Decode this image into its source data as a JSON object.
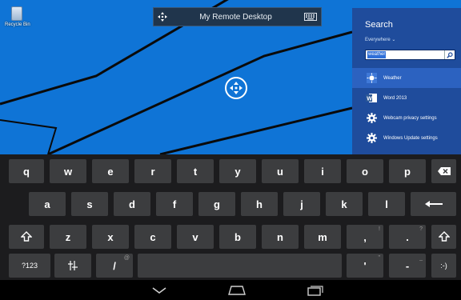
{
  "desktop": {
    "recycle_bin_label": "Recycle Bin"
  },
  "remote_bar": {
    "title": "My Remote Desktop",
    "move_icon": "move-arrows-icon",
    "keyboard_icon": "keyboard-icon"
  },
  "pan_control": {
    "icon": "pan-arrows-icon"
  },
  "search_charm": {
    "heading": "Search",
    "scope": "Everywhere",
    "query": "weather",
    "results": [
      {
        "label": "Weather",
        "icon": "weather-sun-icon"
      },
      {
        "label": "Word 2013",
        "icon": "word-icon"
      },
      {
        "label": "Webcam privacy settings",
        "icon": "settings-gear-icon"
      },
      {
        "label": "Windows Update settings",
        "icon": "settings-gear-icon"
      }
    ]
  },
  "keyboard": {
    "row1": [
      "q",
      "w",
      "e",
      "r",
      "t",
      "y",
      "u",
      "i",
      "o",
      "p"
    ],
    "row2": [
      "a",
      "s",
      "d",
      "f",
      "g",
      "h",
      "j",
      "k",
      "l"
    ],
    "row3": [
      "z",
      "x",
      "c",
      "v",
      "b",
      "n",
      "m"
    ],
    "comma": ",",
    "comma_hint": "!",
    "period": ".",
    "period_hint": "?",
    "symbols": "?123",
    "slash": "/",
    "slash_hint": "@",
    "apostrophe": "'",
    "apostrophe_hint": "\"",
    "dash": "-",
    "dash_hint": "_",
    "smiley": ":-)"
  },
  "colors": {
    "desktop_blue": "#0f74d6",
    "charm_blue": "#1f4c9c",
    "key_gray": "#3c3d3f"
  }
}
